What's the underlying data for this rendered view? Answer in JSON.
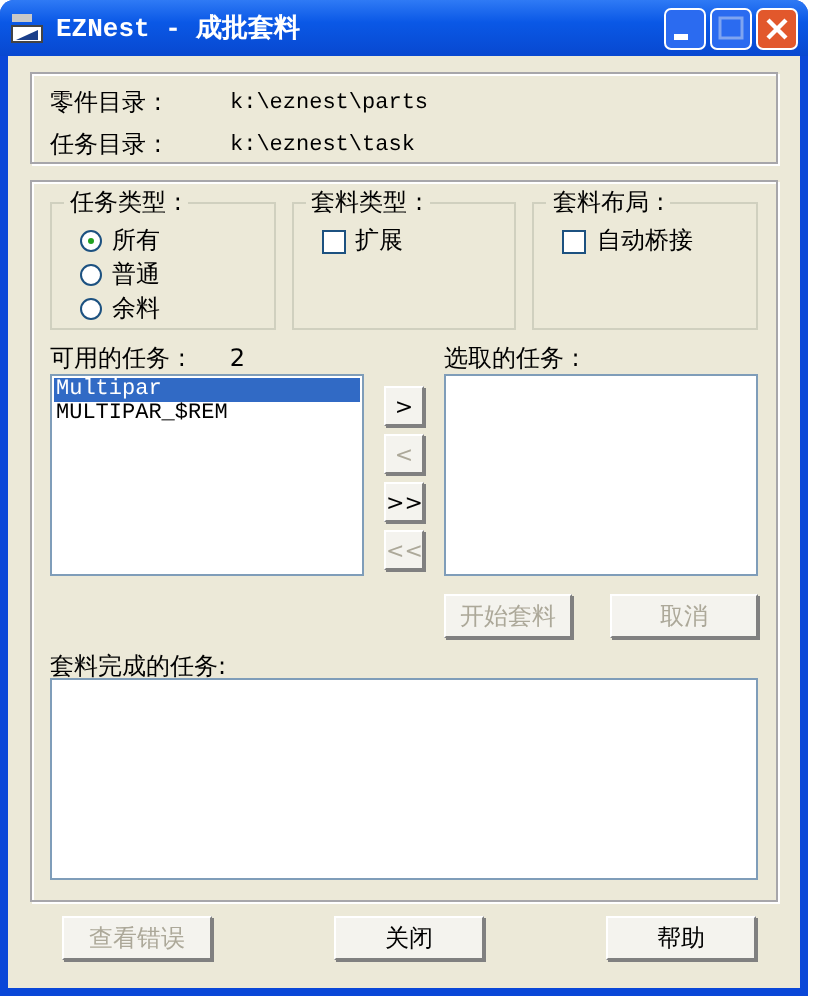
{
  "window": {
    "title": "EZNest - 成批套料"
  },
  "directories": [
    {
      "label": "零件目录 :",
      "path": "k:\\eznest\\parts"
    },
    {
      "label": "任务目录 :",
      "path": "k:\\eznest\\task"
    }
  ],
  "task_type": {
    "title": "任务类型 :",
    "options": [
      {
        "label": "所有",
        "selected": true
      },
      {
        "label": "普通",
        "selected": false
      },
      {
        "label": "余料",
        "selected": false
      }
    ]
  },
  "nest_type": {
    "title": "套料类型 :",
    "checkbox": {
      "label": "扩展",
      "checked": false
    }
  },
  "nest_layout": {
    "title": "套料布局 :",
    "checkbox": {
      "label": "自动桥接",
      "checked": false
    }
  },
  "available": {
    "label": "可用的任务 :",
    "count": "2",
    "items": [
      {
        "text": "Multipar",
        "selected": true
      },
      {
        "text": "MULTIPAR_$REM",
        "selected": false
      }
    ]
  },
  "move_buttons": [
    {
      "label": ">",
      "disabled": false
    },
    {
      "label": "<",
      "disabled": true
    },
    {
      "label": ">>",
      "disabled": false
    },
    {
      "label": "<<",
      "disabled": true
    }
  ],
  "selected_tasks": {
    "label": "选取的任务 :"
  },
  "action_buttons": [
    {
      "label": "开始套料",
      "disabled": true
    },
    {
      "label": "取消",
      "disabled": true
    }
  ],
  "completed": {
    "label": "套料完成的任务:"
  },
  "footer_buttons": [
    {
      "label": "查看错误",
      "disabled": true
    },
    {
      "label": "关闭",
      "disabled": false
    },
    {
      "label": "帮助",
      "disabled": false
    }
  ]
}
